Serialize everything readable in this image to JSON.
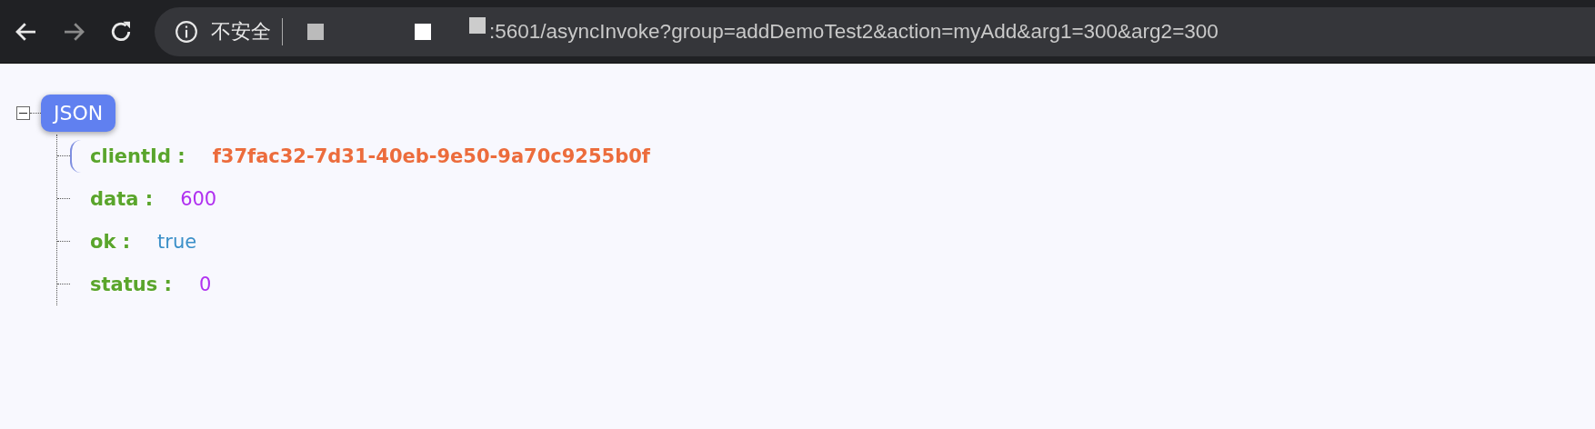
{
  "browser": {
    "security_label": "不安全",
    "url": ":5601/asyncInvoke?group=addDemoTest2&action=myAdd&arg1=300&arg2=300"
  },
  "tree": {
    "root": {
      "label": "JSON",
      "expanded": true
    },
    "items": [
      {
        "key": "clientId :",
        "value": "f37fac32-7d31-40eb-9e50-9a70c9255b0f",
        "kind": "string",
        "selected": true
      },
      {
        "key": "data :",
        "value": "600",
        "kind": "number",
        "selected": false
      },
      {
        "key": "ok :",
        "value": "true",
        "kind": "boolean",
        "selected": false
      },
      {
        "key": "status :",
        "value": "0",
        "kind": "number",
        "selected": false
      }
    ]
  }
}
